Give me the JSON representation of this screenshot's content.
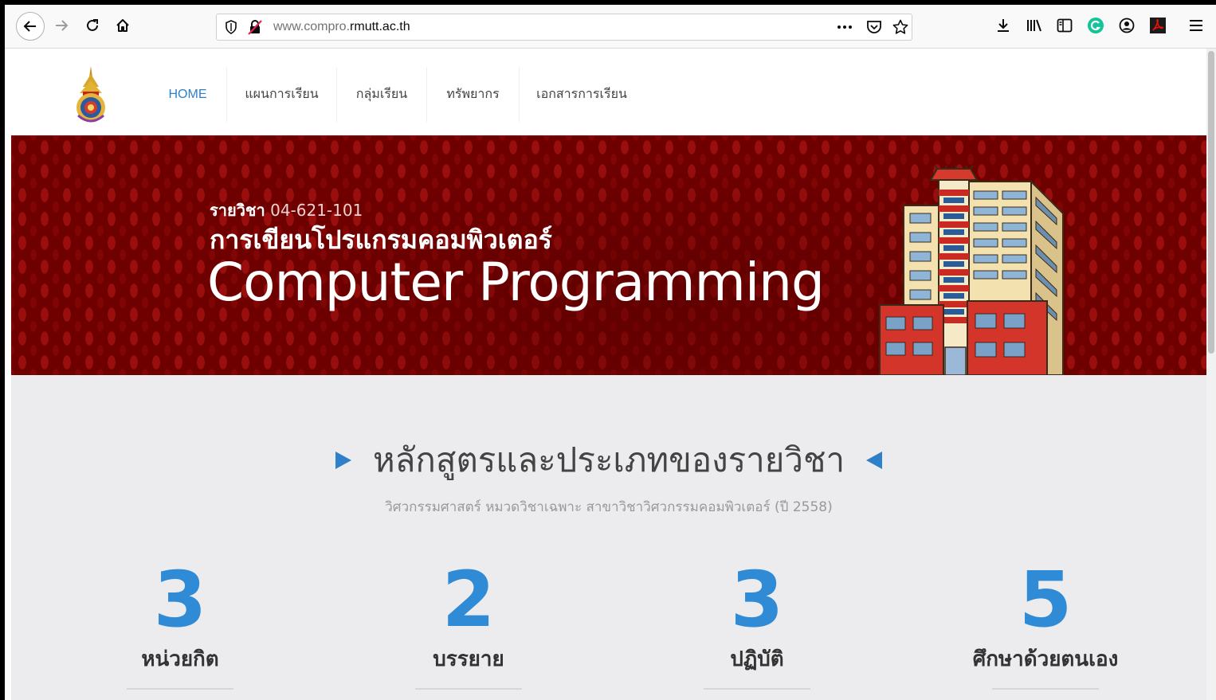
{
  "browser": {
    "url_prefix": "www.compro.",
    "url_host": "rmutt.ac.th",
    "icons": [
      "back-arrow-icon",
      "forward-arrow-icon",
      "reload-icon",
      "home-icon",
      "shield-icon",
      "insecure-lock-icon",
      "more-icon",
      "pocket-icon",
      "star-icon",
      "download-icon",
      "library-icon",
      "sidebar-icon",
      "grammarly-icon",
      "account-icon",
      "pdf-icon",
      "menu-icon"
    ]
  },
  "nav": {
    "items": [
      "HOME",
      "แผนการเรียน",
      "กลุ่มเรียน",
      "ทรัพยากร",
      "เอกสารการเรียน"
    ],
    "active_index": 0
  },
  "hero": {
    "code_label": "รายวิชา",
    "code": "04-621-101",
    "title_th": "การเขียนโปรแกรมคอมพิวเตอร์",
    "title_en": "Computer Programming"
  },
  "section": {
    "title": "หลักสูตรและประเภทของรายวิชา",
    "subtitle": "วิศวกรรมศาสตร์ หมวดวิชาเฉพาะ สาขาวิชาวิศวกรรมคอมพิวเตอร์ (ปี 2558)",
    "stats": [
      {
        "value": "3",
        "label": "หน่วยกิต"
      },
      {
        "value": "2",
        "label": "บรรยาย"
      },
      {
        "value": "3",
        "label": "ปฏิบัติ"
      },
      {
        "value": "5",
        "label": "ศึกษาด้วยตนเอง"
      }
    ]
  },
  "colors": {
    "accent": "#2f80c8",
    "hero_bg": "#6e0000",
    "stat_blue": "#2f8bd6",
    "section_bg": "#ececef"
  }
}
